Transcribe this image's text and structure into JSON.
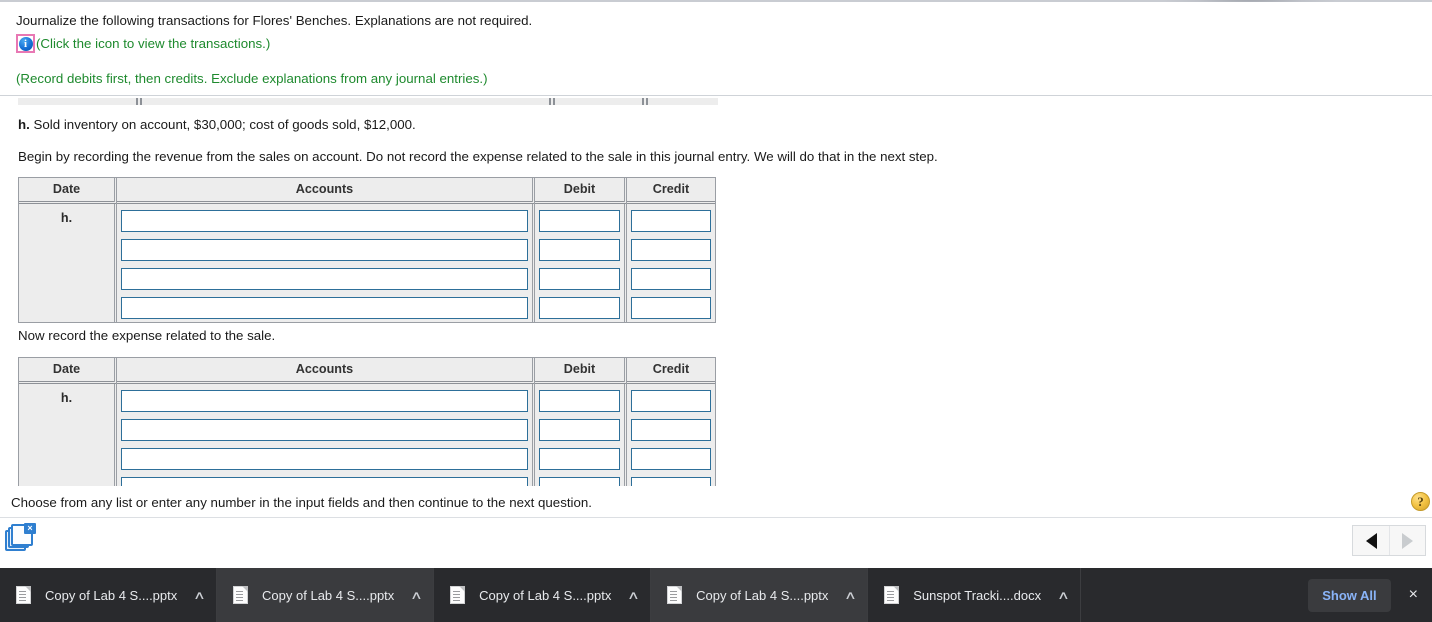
{
  "prompt": {
    "instruction": "Journalize the following transactions for Flores' Benches. Explanations are not required.",
    "icon_name": "info-icon",
    "icon_glyph": "i",
    "icon_link_text": "(Click the icon to view the transactions.)",
    "note": "(Record debits first, then credits. Exclude explanations from any journal entries.)"
  },
  "transaction": {
    "letter": "h.",
    "description": "Sold inventory on account, $30,000; cost of goods sold, $12,000."
  },
  "sections": [
    {
      "intro": "Begin by recording the revenue from the sales on account. Do not record the expense related to the sale in this journal entry. We will do that in the next step.",
      "table": {
        "headers": [
          "Date",
          "Accounts",
          "Debit",
          "Credit"
        ],
        "date_label": "h.",
        "rows": [
          {
            "accounts": "",
            "debit": "",
            "credit": ""
          },
          {
            "accounts": "",
            "debit": "",
            "credit": ""
          },
          {
            "accounts": "",
            "debit": "",
            "credit": ""
          },
          {
            "accounts": "",
            "debit": "",
            "credit": ""
          }
        ]
      }
    },
    {
      "intro": "Now record the expense related to the sale.",
      "table": {
        "headers": [
          "Date",
          "Accounts",
          "Debit",
          "Credit"
        ],
        "date_label": "h.",
        "rows": [
          {
            "accounts": "",
            "debit": "",
            "credit": ""
          },
          {
            "accounts": "",
            "debit": "",
            "credit": ""
          },
          {
            "accounts": "",
            "debit": "",
            "credit": ""
          },
          {
            "accounts": "",
            "debit": "",
            "credit": ""
          }
        ]
      }
    }
  ],
  "footer": {
    "text": "Choose from any list or enter any number in the input fields and then continue to the next question.",
    "help_glyph": "?",
    "restore_close_glyph": "×",
    "prev_label": "◀",
    "next_label": "▶"
  },
  "download_shelf": {
    "items": [
      {
        "name": "Copy of Lab 4 S....pptx",
        "chevron": "∧",
        "highlighted": false
      },
      {
        "name": "Copy of Lab 4 S....pptx",
        "chevron": "∧",
        "highlighted": true
      },
      {
        "name": "Copy of Lab 4 S....pptx",
        "chevron": "∧",
        "highlighted": false
      },
      {
        "name": "Copy of Lab 4 S....pptx",
        "chevron": "∧",
        "highlighted": true
      },
      {
        "name": "Sunspot Tracki....docx",
        "chevron": "∧",
        "highlighted": false
      }
    ],
    "show_all_label": "Show All",
    "close_glyph": "×"
  },
  "colors": {
    "green_text": "#1e8a2e",
    "input_border": "#2d6f99",
    "table_bg": "#ededed",
    "shelf_bg": "#292a2d",
    "show_all_text": "#8ab4f8",
    "help_gold": "#f2c242",
    "info_icon_border": "#e878b4"
  }
}
